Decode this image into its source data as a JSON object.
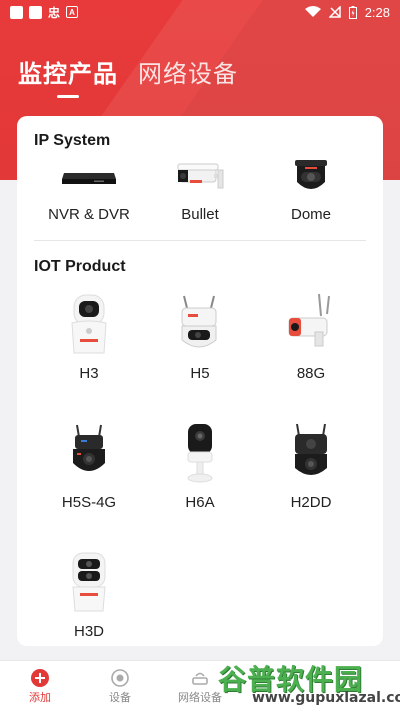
{
  "status_bar": {
    "time": "2:28",
    "glyph": "忠",
    "a_icon": "A"
  },
  "tabs": [
    {
      "label": "监控产品",
      "active": true
    },
    {
      "label": "网络设备",
      "active": false
    }
  ],
  "sections": [
    {
      "title": "IP System",
      "items": [
        {
          "label": "NVR & DVR",
          "icon": "nvr-icon"
        },
        {
          "label": "Bullet",
          "icon": "bullet-camera-icon"
        },
        {
          "label": "Dome",
          "icon": "dome-camera-icon"
        }
      ]
    },
    {
      "title": "IOT Product",
      "items": [
        {
          "label": "H3",
          "icon": "h3-camera-icon"
        },
        {
          "label": "H5",
          "icon": "h5-camera-icon"
        },
        {
          "label": "88G",
          "icon": "88g-camera-icon"
        },
        {
          "label": "H5S-4G",
          "icon": "h5s-4g-camera-icon"
        },
        {
          "label": "H6A",
          "icon": "h6a-camera-icon"
        },
        {
          "label": "H2DD",
          "icon": "h2dd-camera-icon"
        },
        {
          "label": "H3D",
          "icon": "h3d-camera-icon"
        }
      ]
    }
  ],
  "bottom_nav": [
    {
      "label": "添加",
      "icon": "add-icon",
      "active": true
    },
    {
      "label": "设备",
      "icon": "device-icon",
      "active": false
    },
    {
      "label": "网络设备",
      "icon": "network-icon",
      "active": false
    }
  ],
  "watermark": {
    "title": "谷普软件园",
    "url": "www.gupuxlazal.com"
  },
  "colors": {
    "accent": "#e23838",
    "watermark_green": "#4caf50"
  }
}
